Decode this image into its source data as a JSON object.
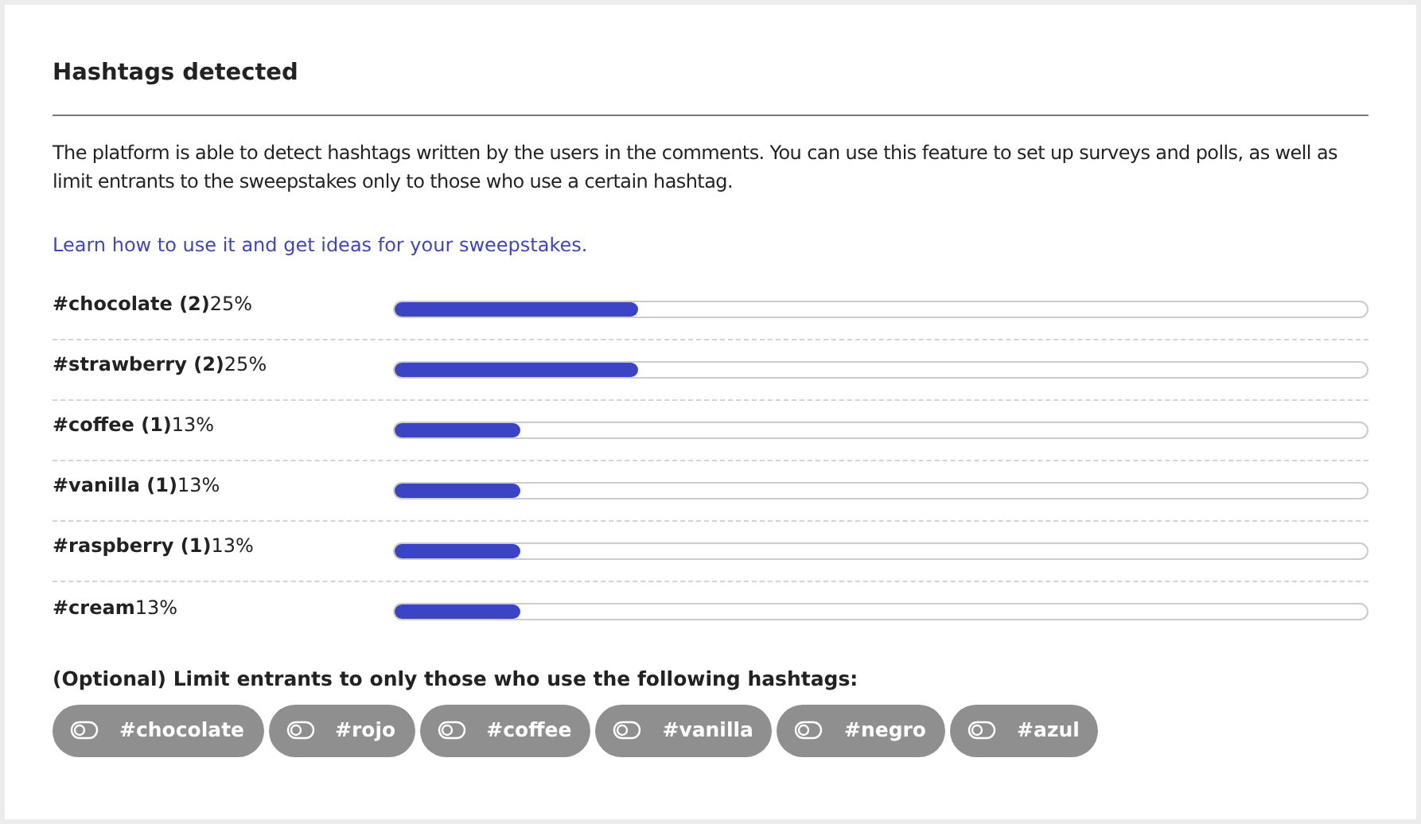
{
  "title": "Hashtags detected",
  "description": "The platform is able to detect hashtags written by the users in the comments. You can use this feature to set up surveys and polls, as well as limit entrants to the sweepstakes only to those who use a certain hashtag.",
  "link": "Learn how to use it and get ideas for your sweepstakes.",
  "hashtags": [
    {
      "tag": "#chocolate (2)",
      "percent": "25%",
      "level": 0.25
    },
    {
      "tag": "#strawberry (2)",
      "percent": "25%",
      "level": 0.25
    },
    {
      "tag": "#coffee (1)",
      "percent": "13%",
      "level": 0.13
    },
    {
      "tag": "#vanilla (1)",
      "percent": "13%",
      "level": 0.13
    },
    {
      "tag": "#raspberry (1)",
      "percent": "13%",
      "level": 0.13
    },
    {
      "tag": "#cream",
      "percent": "13%",
      "level": 0.13
    }
  ],
  "filter_label": "(Optional) Limit entrants to only those who use the following hashtags:",
  "filter_chips": [
    {
      "label": "#chocolate",
      "on": false
    },
    {
      "label": "#rojo",
      "on": false
    },
    {
      "label": "#coffee",
      "on": false
    },
    {
      "label": "#vanilla",
      "on": false
    },
    {
      "label": "#negro",
      "on": false
    },
    {
      "label": "#azul",
      "on": false
    }
  ]
}
